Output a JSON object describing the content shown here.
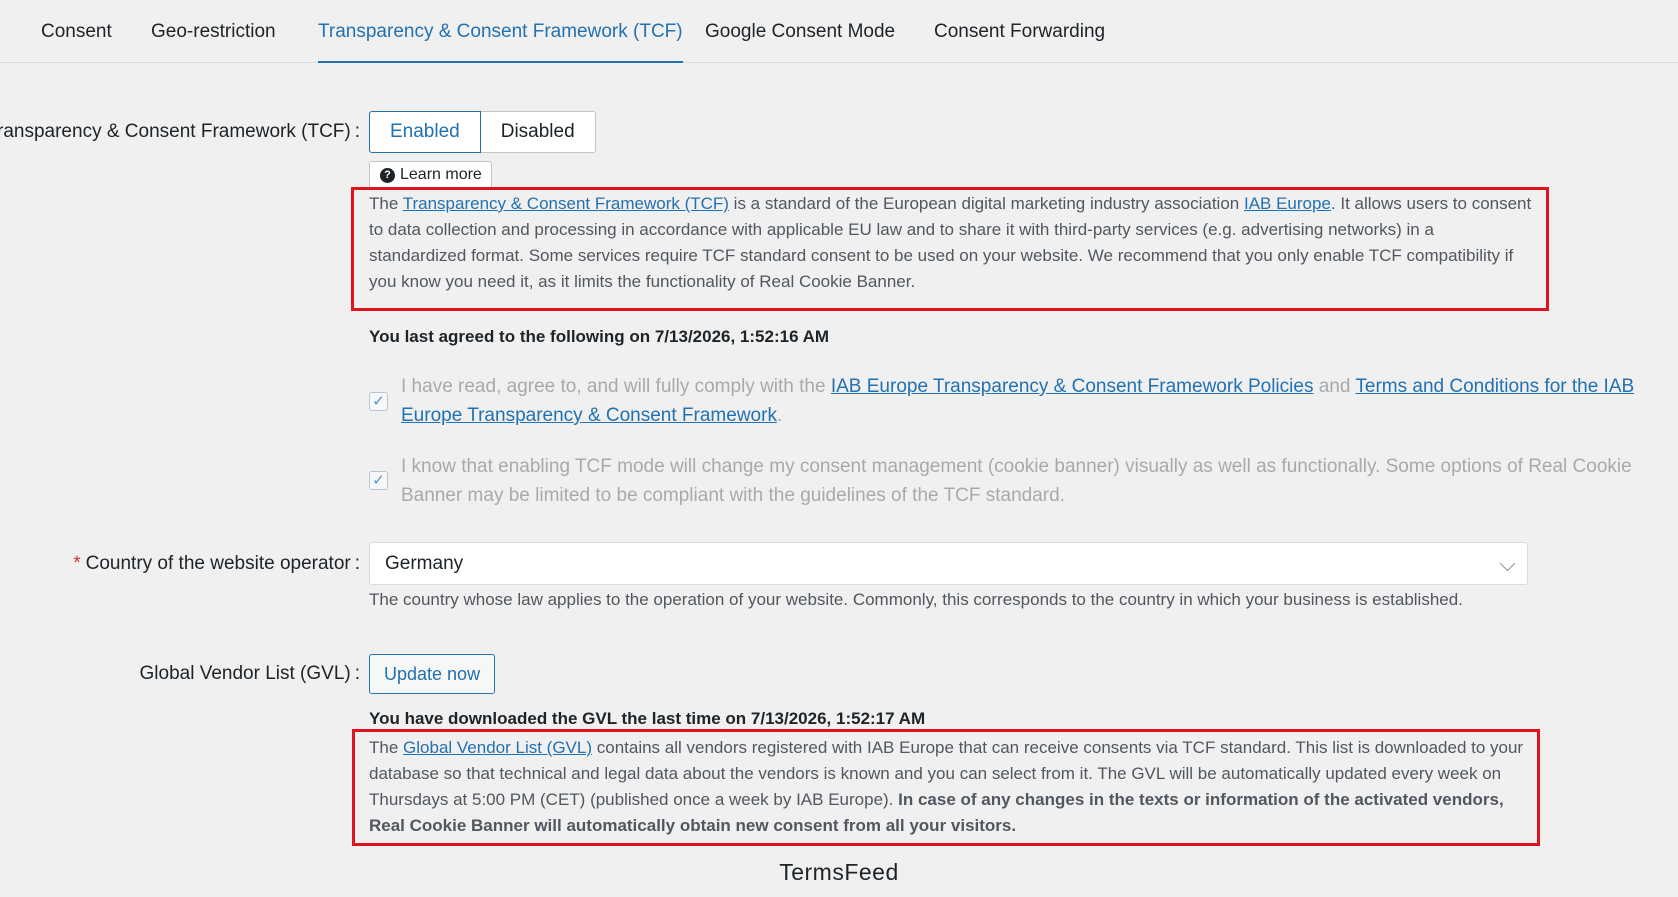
{
  "tabs": [
    {
      "label": "Consent",
      "active": false
    },
    {
      "label": "Geo-restriction",
      "active": false
    },
    {
      "label": "Transparency & Consent Framework (TCF)",
      "active": true
    },
    {
      "label": "Google Consent Mode",
      "active": false
    },
    {
      "label": "Consent Forwarding",
      "active": false
    }
  ],
  "tcf": {
    "label": "Transparency & Consent Framework (TCF)",
    "enabled_label": "Enabled",
    "disabled_label": "Disabled",
    "learn_more": "Learn more",
    "desc_1": "The ",
    "desc_link_1": "Transparency & Consent Framework (TCF)",
    "desc_2": " is a standard of the European digital marketing industry association ",
    "desc_link_2": "IAB Europe",
    "desc_3": ". It allows users to consent to data collection and processing in accordance with applicable EU law and to share it with third-party services (e.g. advertising networks) in a standardized format. Some services require TCF standard consent to be used on your website. We recommend that you only enable TCF compatibility if you know you need it, as it limits the functionality of Real Cookie Banner.",
    "last_agreed": "You last agreed to the following on 7/13/2026, 1:52:16 AM",
    "check_1_a": "I have read, agree to, and will fully comply with the ",
    "check_1_link_1": "IAB Europe Transparency & Consent Framework Policies",
    "check_1_b": " and ",
    "check_1_link_2": "Terms and Conditions for the IAB Europe Transparency & Consent Framework",
    "check_1_c": ".",
    "check_2": "I know that enabling TCF mode will change my consent management (cookie banner) visually as well as functionally. Some options of Real Cookie Banner may be limited to be compliant with the guidelines of the TCF standard."
  },
  "country": {
    "required_mark": "*",
    "label": "Country of the website operator",
    "value": "Germany",
    "help": "The country whose law applies to the operation of your website. Commonly, this corresponds to the country in which your business is established."
  },
  "gvl": {
    "label": "Global Vendor List (GVL)",
    "button": "Update now",
    "last_download": "You have downloaded the GVL the last time on 7/13/2026, 1:52:17 AM",
    "desc_1": "The ",
    "desc_link": "Global Vendor List (GVL)",
    "desc_2": " contains all vendors registered with IAB Europe that can receive consents via TCF standard. This list is downloaded to your database so that technical and legal data about the vendors is known and you can select from it. The GVL will be automatically updated every week on Thursdays at 5:00 PM (CET) (published once a week by IAB Europe). ",
    "desc_bold": "In case of any changes in the texts or information of the activated vendors, Real Cookie Banner will automatically obtain new consent from all your visitors."
  },
  "footer": "TermsFeed",
  "colors": {
    "accent": "#2271b1",
    "highlight_box": "#e0141e",
    "required": "#d63638"
  }
}
